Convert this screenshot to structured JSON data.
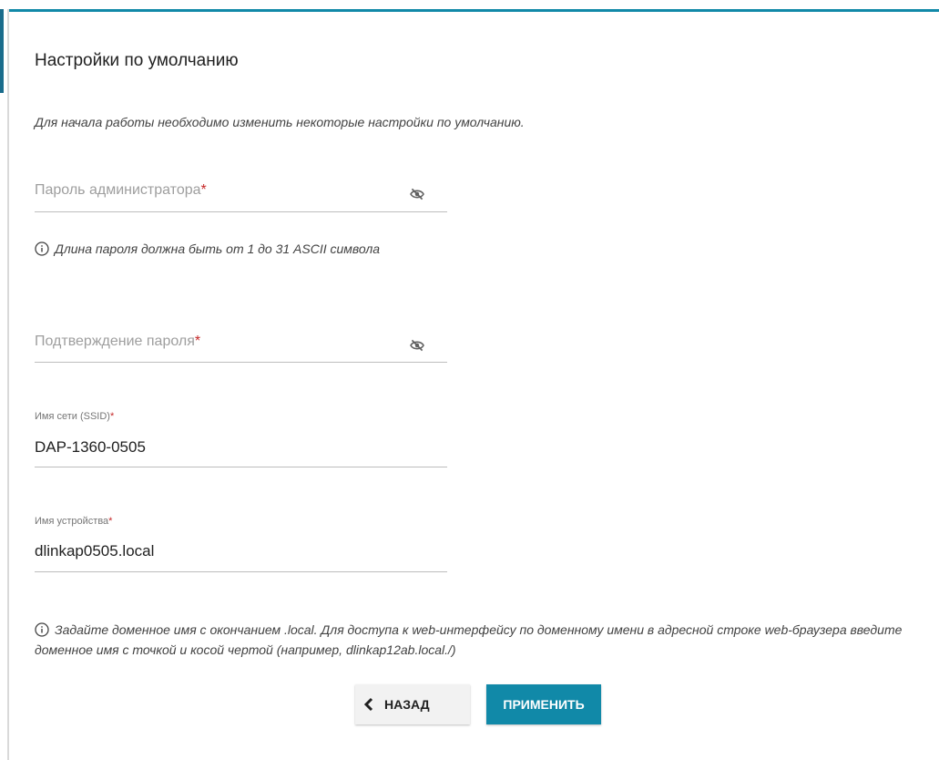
{
  "page": {
    "title": "Настройки по умолчанию",
    "intro": "Для начала работы необходимо изменить некоторые настройки по умолчанию."
  },
  "fields": {
    "admin_password": {
      "placeholder": "Пароль администратора",
      "required_mark": "*",
      "icon": "eye-off-icon",
      "hint": "Длина пароля должна быть от 1 до 31 ASCII символа"
    },
    "confirm_password": {
      "placeholder": "Подтверждение пароля",
      "required_mark": "*",
      "icon": "eye-off-icon"
    },
    "ssid": {
      "label": "Имя сети (SSID)",
      "required_mark": "*",
      "value": "DAP-1360-0505"
    },
    "device_name": {
      "label": "Имя устройства",
      "required_mark": "*",
      "value": "dlinkap0505.local"
    }
  },
  "domain_hint": "Задайте доменное имя с окончанием .local. Для доступа к web-интерфейсу по доменному имени в адресной строке web-браузера введите доменное имя с точкой и косой чертой (например, dlinkap12ab.local./)",
  "buttons": {
    "back_label": "НАЗАД",
    "apply_label": "ПРИМЕНИТЬ"
  },
  "colors": {
    "accent": "#1189a8",
    "required": "#c62828"
  }
}
